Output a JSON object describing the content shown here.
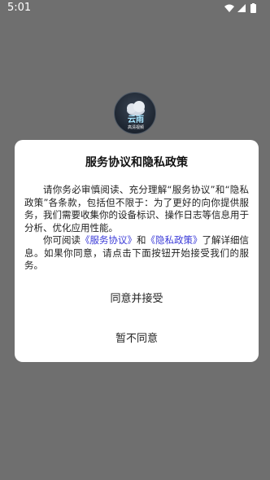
{
  "status_bar": {
    "time": "5:01",
    "icons": [
      "wifi-icon",
      "signal-icon",
      "battery-icon"
    ]
  },
  "logo": {
    "text_line1": "云雨",
    "text_line2": "高清视频",
    "icon": "cloud-logo-icon"
  },
  "dialog": {
    "title": "服务协议和隐私政策",
    "para1": "请你务必审慎阅读、充分理解“服务协议”和“隐私政策”各条款，包括但不限于：为了更好的向你提供服务，我们需要收集你的设备标识、操作日志等信息用于分析、优化应用性能。",
    "para2_prefix": "你可阅读",
    "link_service": "《服务协议》",
    "para2_and": "和",
    "link_privacy": "《隐私政策》",
    "para2_suffix": "了解详细信息。如果你同意，请点击下面按钮开始接受我们的服务。",
    "accept_label": "同意并接受",
    "decline_label": "暂不同意"
  },
  "colors": {
    "overlay": "#6f6f6f",
    "dialog_bg": "#ffffff",
    "link": "#3a3ad8",
    "text": "#222222"
  }
}
